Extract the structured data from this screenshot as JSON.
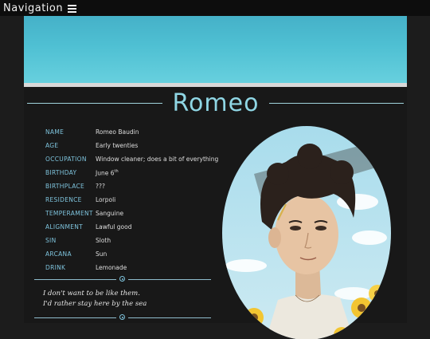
{
  "nav": {
    "label": "Navigation",
    "menu_icon": "hamburger-icon"
  },
  "title": "Romeo",
  "colors": {
    "accent": "#7ec3dc",
    "banner": "#4fc0d3",
    "background": "#181818"
  },
  "info": [
    {
      "key": "NAME",
      "value": "Romeo Baudin"
    },
    {
      "key": "AGE",
      "value": "Early twenties"
    },
    {
      "key": "OCCUPATION",
      "value": "Window cleaner; does a bit of everything"
    },
    {
      "key": "BIRTHDAY",
      "value": "June 6",
      "sup": "th"
    },
    {
      "key": "BIRTHPLACE",
      "value": "???"
    },
    {
      "key": "RESIDENCE",
      "value": "Lorpoli"
    },
    {
      "key": "TEMPERAMENT",
      "value": "Sanguine"
    },
    {
      "key": "ALIGNMENT",
      "value": "Lawful good"
    },
    {
      "key": "SIN",
      "value": "Sloth"
    },
    {
      "key": "ARCANA",
      "value": "Sun"
    },
    {
      "key": "DRINK",
      "value": "Lemonade"
    }
  ],
  "quote": [
    "I don't want to be like them.",
    "I'd rather stay here by the sea"
  ]
}
